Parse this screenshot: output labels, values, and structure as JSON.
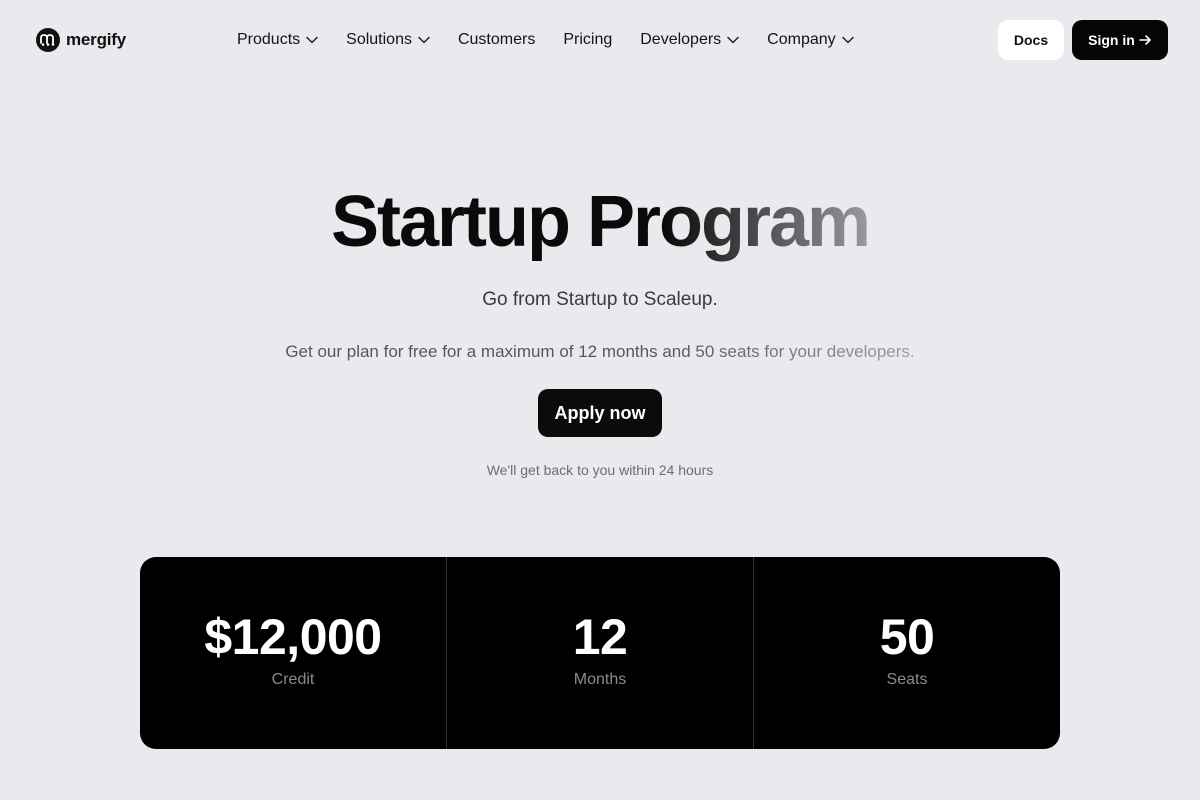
{
  "header": {
    "logo_text": "mergify",
    "nav": [
      {
        "label": "Products",
        "has_dropdown": true
      },
      {
        "label": "Solutions",
        "has_dropdown": true
      },
      {
        "label": "Customers",
        "has_dropdown": false
      },
      {
        "label": "Pricing",
        "has_dropdown": false
      },
      {
        "label": "Developers",
        "has_dropdown": true
      },
      {
        "label": "Company",
        "has_dropdown": true
      }
    ],
    "docs_label": "Docs",
    "signin_label": "Sign in",
    "signin_icon": "arrow-right-icon"
  },
  "hero": {
    "title": "Startup Program",
    "subtitle": "Go from Startup to Scaleup.",
    "description": "Get our plan for free for a maximum of 12 months and 50 seats for your developers.",
    "cta_label": "Apply now",
    "note": "We'll get back to you within 24 hours"
  },
  "stats": [
    {
      "value": "$12,000",
      "label": "Credit"
    },
    {
      "value": "12",
      "label": "Months"
    },
    {
      "value": "50",
      "label": "Seats"
    }
  ],
  "colors": {
    "background": "#e9e9ee",
    "primary_dark": "#050505",
    "stats_background": "#000000"
  }
}
